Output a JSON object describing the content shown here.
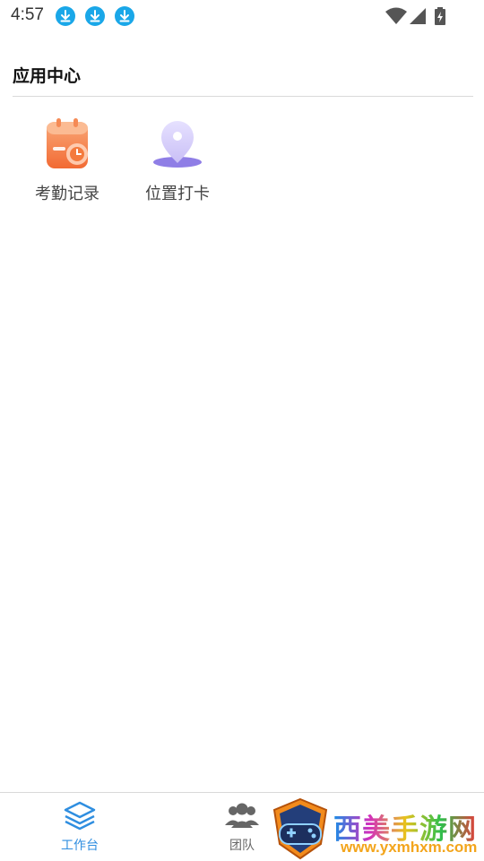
{
  "status_bar": {
    "time": "4:57",
    "notification_icons": [
      "download-icon",
      "download-icon",
      "download-icon"
    ],
    "system_icons": [
      "wifi-icon",
      "cell-signal-icon",
      "battery-icon"
    ]
  },
  "header": {
    "title": "应用中心"
  },
  "apps": [
    {
      "label": "考勤记录",
      "icon": "calendar-clock-icon"
    },
    {
      "label": "位置打卡",
      "icon": "location-pin-icon"
    }
  ],
  "bottom_nav": {
    "items": [
      {
        "label": "工作台",
        "icon": "layers-icon",
        "active": true
      },
      {
        "label": "团队",
        "icon": "team-icon",
        "active": false
      }
    ],
    "active_color": "#2f8ee0",
    "inactive_color": "#666666"
  },
  "watermark": {
    "text": "西美手游网",
    "url": "www.yxmhxm.com"
  },
  "colors": {
    "download_badge": "#1aa7e8",
    "attendance_orange": "#f47a3d",
    "location_purple": "#8f7ee6"
  }
}
